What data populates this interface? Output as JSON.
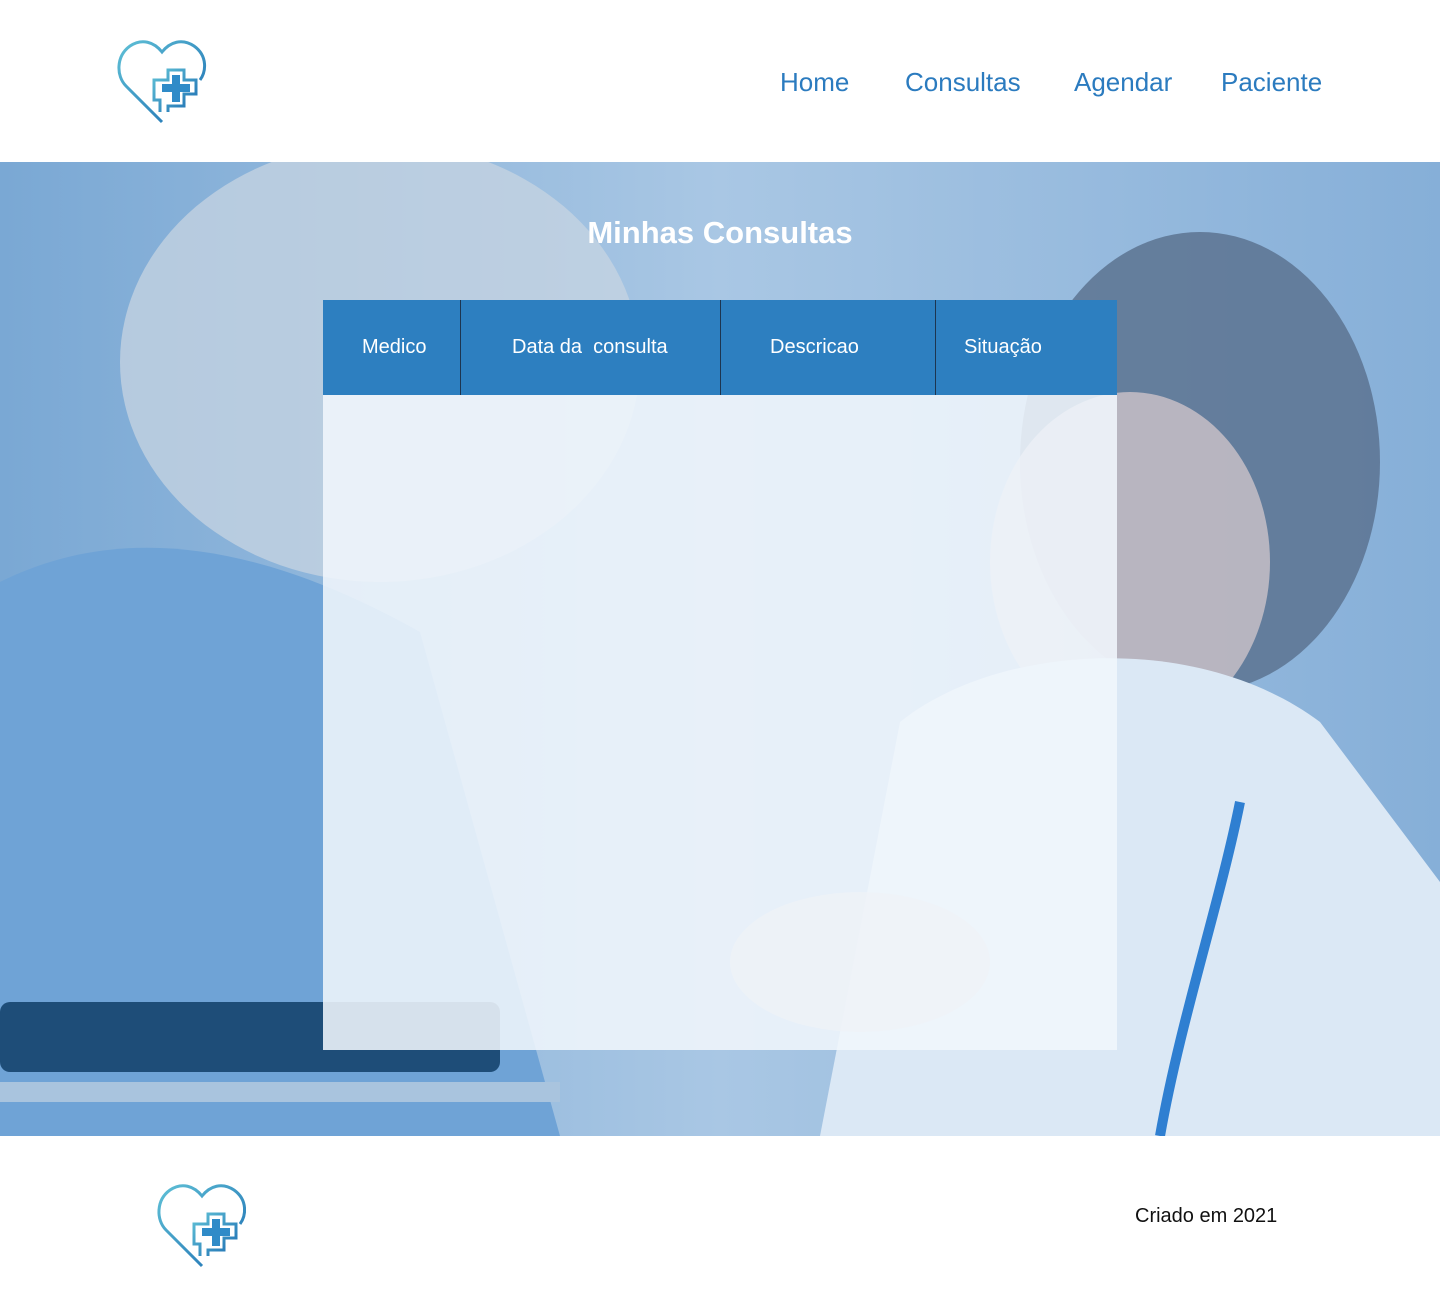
{
  "header": {
    "logo_icon": "heart-medical-cross-icon",
    "nav": [
      {
        "label": "Home"
      },
      {
        "label": "Consultas"
      },
      {
        "label": "Agendar"
      },
      {
        "label": "Paciente"
      }
    ]
  },
  "main": {
    "title": "Minhas Consultas",
    "table": {
      "columns": [
        "Medico",
        "Data da  consulta",
        "Descricao",
        "Situação"
      ],
      "rows": []
    }
  },
  "footer": {
    "logo_icon": "heart-medical-cross-icon",
    "credit": "Criado em 2021"
  },
  "colors": {
    "brand": "#2b7bbf",
    "table_header": "#2d7fc0",
    "hero_overlay": "#8fb4d8"
  }
}
